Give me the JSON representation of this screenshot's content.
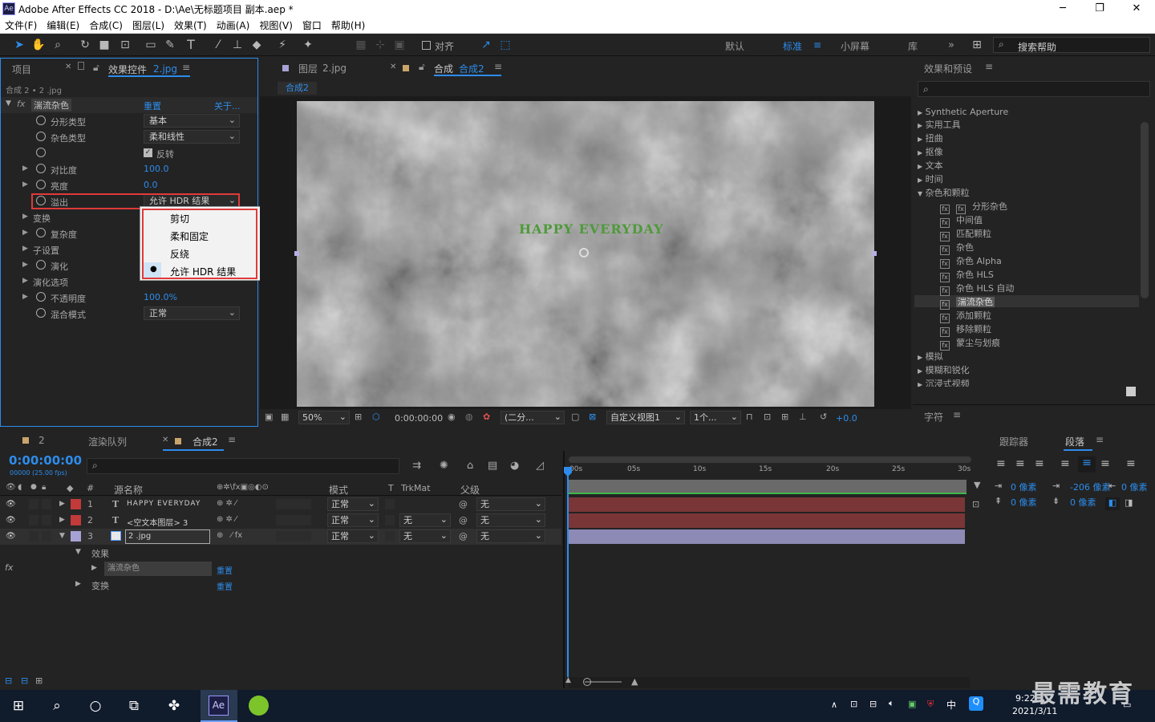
{
  "window": {
    "title": "Adobe After Effects CC 2018 - D:\\Ae\\无标题项目 副本.aep *",
    "app_icon": "Ae"
  },
  "menu": [
    "文件(F)",
    "编辑(E)",
    "合成(C)",
    "图层(L)",
    "效果(T)",
    "动画(A)",
    "视图(V)",
    "窗口",
    "帮助(H)"
  ],
  "toolbar": {
    "align_label": "对齐",
    "workspaces": [
      "默认",
      "标准",
      "小屏幕",
      "库"
    ],
    "active_workspace": "标准",
    "search_help": "搜索帮助"
  },
  "project_panel": {
    "tab_project": "项目",
    "tab_effects": "效果控件",
    "tab_effects_target": "2.jpg",
    "breadcrumb": "合成 2 • 2 .jpg"
  },
  "effect": {
    "name": "湍流杂色",
    "reset": "重置",
    "about": "关于...",
    "props": [
      {
        "label": "分形类型",
        "value": "基本",
        "type": "dropdown"
      },
      {
        "label": "杂色类型",
        "value": "柔和线性",
        "type": "dropdown"
      },
      {
        "label": "",
        "value": "反转",
        "type": "checkbox"
      },
      {
        "label": "对比度",
        "value": "100.0",
        "type": "number"
      },
      {
        "label": "亮度",
        "value": "0.0",
        "type": "number"
      },
      {
        "label": "溢出",
        "value": "允许 HDR 结果",
        "type": "dropdown"
      },
      {
        "label": "变换",
        "value": "",
        "type": "group"
      },
      {
        "label": "复杂度",
        "value": "",
        "type": "number"
      },
      {
        "label": "子设置",
        "value": "",
        "type": "group"
      },
      {
        "label": "演化",
        "value": "",
        "type": "number"
      },
      {
        "label": "演化选项",
        "value": "",
        "type": "group"
      },
      {
        "label": "不透明度",
        "value": "100.0%",
        "type": "number"
      },
      {
        "label": "混合模式",
        "value": "正常",
        "type": "dropdown"
      }
    ]
  },
  "overflow_menu": {
    "options": [
      "剪切",
      "柔和固定",
      "反绕",
      "允许 HDR 结果"
    ],
    "selected": "允许 HDR 结果"
  },
  "viewer": {
    "tab_layer": "图层",
    "tab_layer_target": "2.jpg",
    "tab_comp": "合成",
    "tab_comp_target": "合成2",
    "comp_chip": "合成2",
    "canvas_text": "HAPPY EVERYDAY",
    "footer": {
      "zoom": "50%",
      "timecode": "0:00:00:00",
      "resolution": "(二分...",
      "view": "自定义视图1",
      "views": "1个...",
      "exposure": "+0.0"
    }
  },
  "effects_presets": {
    "title": "效果和预设",
    "items": [
      {
        "label": "Synthetic Aperture",
        "level": 0
      },
      {
        "label": "实用工具",
        "level": 0
      },
      {
        "label": "扭曲",
        "level": 0
      },
      {
        "label": "抠像",
        "level": 0
      },
      {
        "label": "文本",
        "level": 0
      },
      {
        "label": "时间",
        "level": 0
      },
      {
        "label": "杂色和颗粒",
        "level": 0,
        "open": true
      },
      {
        "label": "分形杂色",
        "level": 1
      },
      {
        "label": "中间值",
        "level": 1
      },
      {
        "label": "匹配颗粒",
        "level": 1
      },
      {
        "label": "杂色",
        "level": 1
      },
      {
        "label": "杂色 Alpha",
        "level": 1
      },
      {
        "label": "杂色 HLS",
        "level": 1
      },
      {
        "label": "杂色 HLS 自动",
        "level": 1
      },
      {
        "label": "湍流杂色",
        "level": 1,
        "selected": true
      },
      {
        "label": "添加颗粒",
        "level": 1
      },
      {
        "label": "移除颗粒",
        "level": 1
      },
      {
        "label": "蒙尘与划痕",
        "level": 1
      },
      {
        "label": "模拟",
        "level": 0
      },
      {
        "label": "模糊和锐化",
        "level": 0
      },
      {
        "label": "沉浸式视频",
        "level": 0
      }
    ]
  },
  "character_panel": {
    "title": "字符"
  },
  "timeline": {
    "tab_2": "2",
    "tab_render": "渲染队列",
    "tab_comp": "合成2",
    "timecode": "0:00:00:00",
    "fps": "00000 (25.00 fps)",
    "headers": {
      "name": "源名称",
      "mode": "模式",
      "t": "T",
      "trkmat": "TrkMat",
      "parent": "父级"
    },
    "layers": [
      {
        "num": "1",
        "type": "T",
        "name": "HAPPY EVERYDAY",
        "mode": "正常",
        "trkmat": "",
        "parent": "无",
        "color": "#c23a3a"
      },
      {
        "num": "2",
        "type": "T",
        "name": "<空文本图层> 3",
        "mode": "正常",
        "trkmat": "无",
        "parent": "无",
        "color": "#c23a3a"
      },
      {
        "num": "3",
        "type": "img",
        "name": "2 .jpg",
        "mode": "正常",
        "trkmat": "无",
        "parent": "无",
        "color": "#a6a3d4"
      }
    ],
    "sub": {
      "effects": "效果",
      "effect_name": "湍流杂色",
      "reset": "重置",
      "transform": "变换",
      "reset2": "重置"
    },
    "ruler": [
      "00s",
      "05s",
      "10s",
      "15s",
      "20s",
      "25s",
      "30s"
    ]
  },
  "tracker_panel": {
    "tab_tracker": "跟踪器",
    "tab_paragraph": "段落",
    "indent_left": "0 像素",
    "indent_first": "-206 像素",
    "indent_right": "0 像素",
    "space_before": "0 像素",
    "space_after": "0 像素"
  },
  "taskbar": {
    "time": "9:22",
    "date": "2021/3/11",
    "ime": "中",
    "watermark": "最需教育"
  }
}
